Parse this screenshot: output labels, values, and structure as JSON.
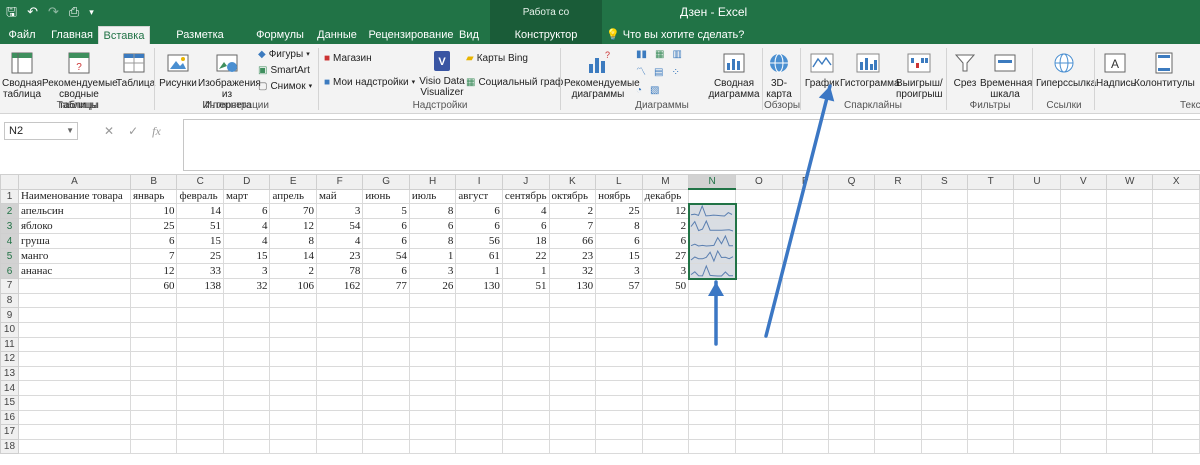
{
  "window": {
    "context_title": "Работа со спарклайнами",
    "app_title": "Дзен - Excel"
  },
  "tabs": [
    "Файл",
    "Главная",
    "Вставка",
    "Разметка страницы",
    "Формулы",
    "Данные",
    "Рецензирование",
    "Вид",
    "Конструктор"
  ],
  "tell_me": "Что вы хотите сделать?",
  "ribbon": {
    "tables": {
      "pivot": "Сводная таблица",
      "recommended_pivot": "Рекомендуемые сводные таблицы",
      "table": "Таблица",
      "group": "Таблицы"
    },
    "illustrations": {
      "pictures": "Рисунки",
      "online_pictures": "Изображения из Интернета",
      "shapes": "Фигуры",
      "smartart": "SmartArt",
      "screenshot": "Снимок",
      "group": "Иллюстрации"
    },
    "addins": {
      "store": "Магазин",
      "my_addins": "Мои надстройки",
      "visio": "Visio Data Visualizer",
      "bing_maps": "Карты Bing",
      "people_graph": "Социальный граф",
      "group": "Надстройки"
    },
    "charts": {
      "recommended": "Рекомендуемые диаграммы",
      "pivot_chart": "Сводная диаграмма",
      "group": "Диаграммы"
    },
    "tours": {
      "map3d": "3D-карта",
      "group": "Обзоры"
    },
    "sparklines": {
      "line": "График",
      "column": "Гистограмма",
      "winloss": "Выигрыш/ проигрыш",
      "group": "Спарклайны"
    },
    "filters": {
      "slicer": "Срез",
      "timeline": "Временная шкала",
      "group": "Фильтры"
    },
    "links": {
      "hyperlink": "Гиперссылка",
      "group": "Ссылки"
    },
    "text": {
      "textbox": "Надпись",
      "header_footer": "Колонтитулы",
      "group": "Текс"
    }
  },
  "formula_bar": {
    "name_box": "N2",
    "fx": "fx",
    "content": ""
  },
  "sheet": {
    "columns": [
      "A",
      "B",
      "C",
      "D",
      "E",
      "F",
      "G",
      "H",
      "I",
      "J",
      "K",
      "L",
      "M",
      "N",
      "O",
      "P",
      "Q",
      "R",
      "S",
      "T",
      "U",
      "V",
      "W",
      "X"
    ],
    "rows": [
      "1",
      "2",
      "3",
      "4",
      "5",
      "6",
      "7",
      "8",
      "9",
      "10",
      "11",
      "12",
      "13",
      "14",
      "15",
      "16",
      "17",
      "18"
    ],
    "header_row": [
      "Наименование товара",
      "январь",
      "февраль",
      "март",
      "апрель",
      "май",
      "июнь",
      "июль",
      "август",
      "сентябрь",
      "октябрь",
      "ноябрь",
      "декабрь"
    ],
    "items": [
      {
        "name": "апельсин",
        "values": [
          10,
          14,
          6,
          70,
          3,
          5,
          8,
          6,
          4,
          2,
          25,
          12
        ]
      },
      {
        "name": "яблоко",
        "values": [
          25,
          51,
          4,
          12,
          54,
          6,
          6,
          6,
          6,
          7,
          8,
          2
        ]
      },
      {
        "name": "груша",
        "values": [
          6,
          15,
          4,
          8,
          4,
          6,
          8,
          56,
          18,
          66,
          6,
          6
        ]
      },
      {
        "name": "манго",
        "values": [
          7,
          25,
          15,
          14,
          23,
          54,
          1,
          61,
          22,
          23,
          15,
          27
        ]
      },
      {
        "name": "ананас",
        "values": [
          12,
          33,
          3,
          2,
          78,
          6,
          3,
          1,
          1,
          32,
          3,
          3
        ]
      }
    ],
    "totals": [
      60,
      138,
      32,
      106,
      162,
      77,
      26,
      130,
      51,
      130,
      57,
      50
    ],
    "selected_cell": "N2",
    "sparkline_color": "#5b7fb0",
    "sparkline_bg": "#d9dde3",
    "accent": "#217346",
    "annotation_arrow_color": "#3b77c4"
  }
}
